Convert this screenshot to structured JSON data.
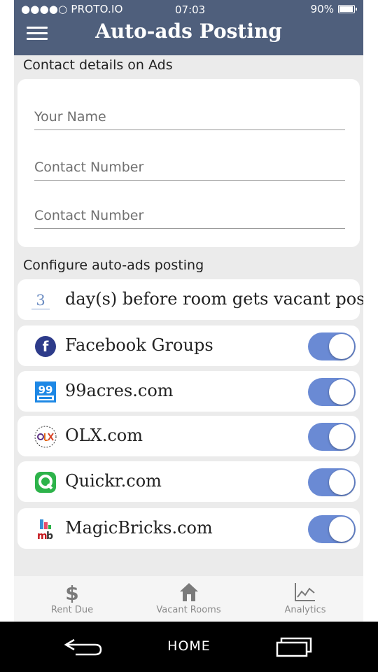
{
  "status": {
    "carrier": "●●●●○ PROTO.IO",
    "time": "07:03",
    "battery": "90%"
  },
  "header": {
    "title": "Auto-ads Posting"
  },
  "contact_section": {
    "label": "Contact details on Ads",
    "name_placeholder": "Your Name",
    "contact1_placeholder": "Contact Number",
    "contact2_placeholder": "Contact Number"
  },
  "config_section": {
    "label": "Configure auto-ads posting",
    "days_value": "3",
    "days_text": "day(s) before room gets vacant post Ad."
  },
  "sites": [
    {
      "label": "Facebook Groups",
      "enabled": true,
      "icon": "facebook-icon"
    },
    {
      "label": "99acres.com",
      "enabled": true,
      "icon": "99acres-icon"
    },
    {
      "label": "OLX.com",
      "enabled": true,
      "icon": "olx-icon"
    },
    {
      "label": "Quickr.com",
      "enabled": true,
      "icon": "quikr-icon"
    },
    {
      "label": "MagicBricks.com",
      "enabled": true,
      "icon": "magicbricks-icon"
    }
  ],
  "tabs": [
    {
      "label": "Rent Due",
      "icon": "dollar-icon"
    },
    {
      "label": "Vacant Rooms",
      "icon": "house-icon"
    },
    {
      "label": "Analytics",
      "icon": "chart-icon"
    }
  ],
  "nav": {
    "home": "HOME"
  },
  "colors": {
    "header": "#4f5f7c",
    "toggle_on": "#6a8ad4",
    "background": "#ebebeb"
  }
}
